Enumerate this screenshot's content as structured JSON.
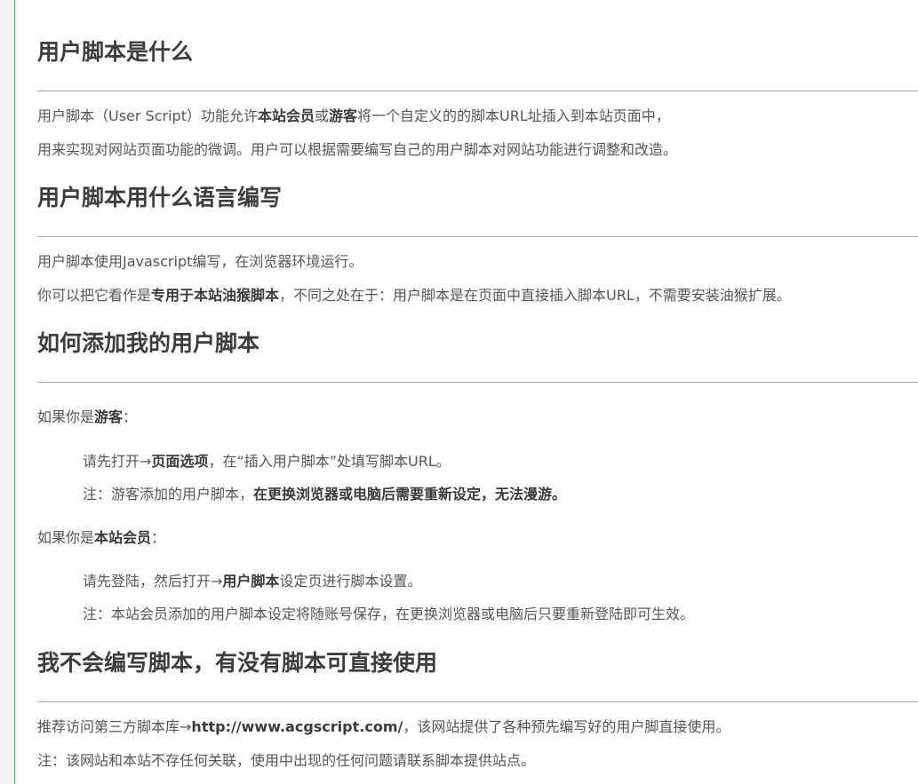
{
  "sections": [
    {
      "heading": "用户脚本是什么",
      "lines": [
        {
          "pre": "用户脚本（User Script）功能允许",
          "b1": "本站会员",
          "mid": "或",
          "b2": "游客",
          "post": "将一个自定义的的脚本URL址插入到本站页面中，"
        },
        {
          "text": "用来实现对网站页面功能的微调。用户可以根据需要编写自己的用户脚本对网站功能进行调整和改造。"
        }
      ]
    },
    {
      "heading": "用户脚本用什么语言编写",
      "lines": [
        {
          "text": "用户脚本使用Javascript编写，在浏览器环境运行。"
        },
        {
          "pre": "你可以把它看作是",
          "bold": "专用于本站油猴脚本",
          "post": "，不同之处在于：用户脚本是在页面中直接插入脚本URL，不需要安装油猴扩展。"
        }
      ]
    },
    {
      "heading": "如何添加我的用户脚本",
      "guest": {
        "pre": "如果你是",
        "bold": "游客",
        "post": "："
      },
      "guest_step1": {
        "pre": "请先打开→",
        "link": "页面选项",
        "post": "，在“插入用户脚本”处填写脚本URL。"
      },
      "guest_note": {
        "pre": "注：游客添加的用户脚本，",
        "bold": "在更换浏览器或电脑后需要重新设定，无法漫游。"
      },
      "member": {
        "pre": "如果你是",
        "bold": "本站会员",
        "post": "："
      },
      "member_step1": {
        "pre": "请先登陆，然后打开→",
        "link": "用户脚本",
        "post": "设定页进行脚本设置。"
      },
      "member_note": {
        "text": "注：本站会员添加的用户脚本设定将随账号保存，在更换浏览器或电脑后只要重新登陆即可生效。"
      }
    },
    {
      "heading": "我不会编写脚本，有没有脚本可直接使用",
      "lines": [
        {
          "pre": "推荐访问第三方脚本库→",
          "link": "http://www.acgscript.com/",
          "post": "，该网站提供了各种预先编写好的用户脚直接使用。"
        },
        {
          "text": "注：该网站和本站不存任何关联，使用中出现的任何问题请联系脚本提供站点。"
        }
      ]
    }
  ]
}
